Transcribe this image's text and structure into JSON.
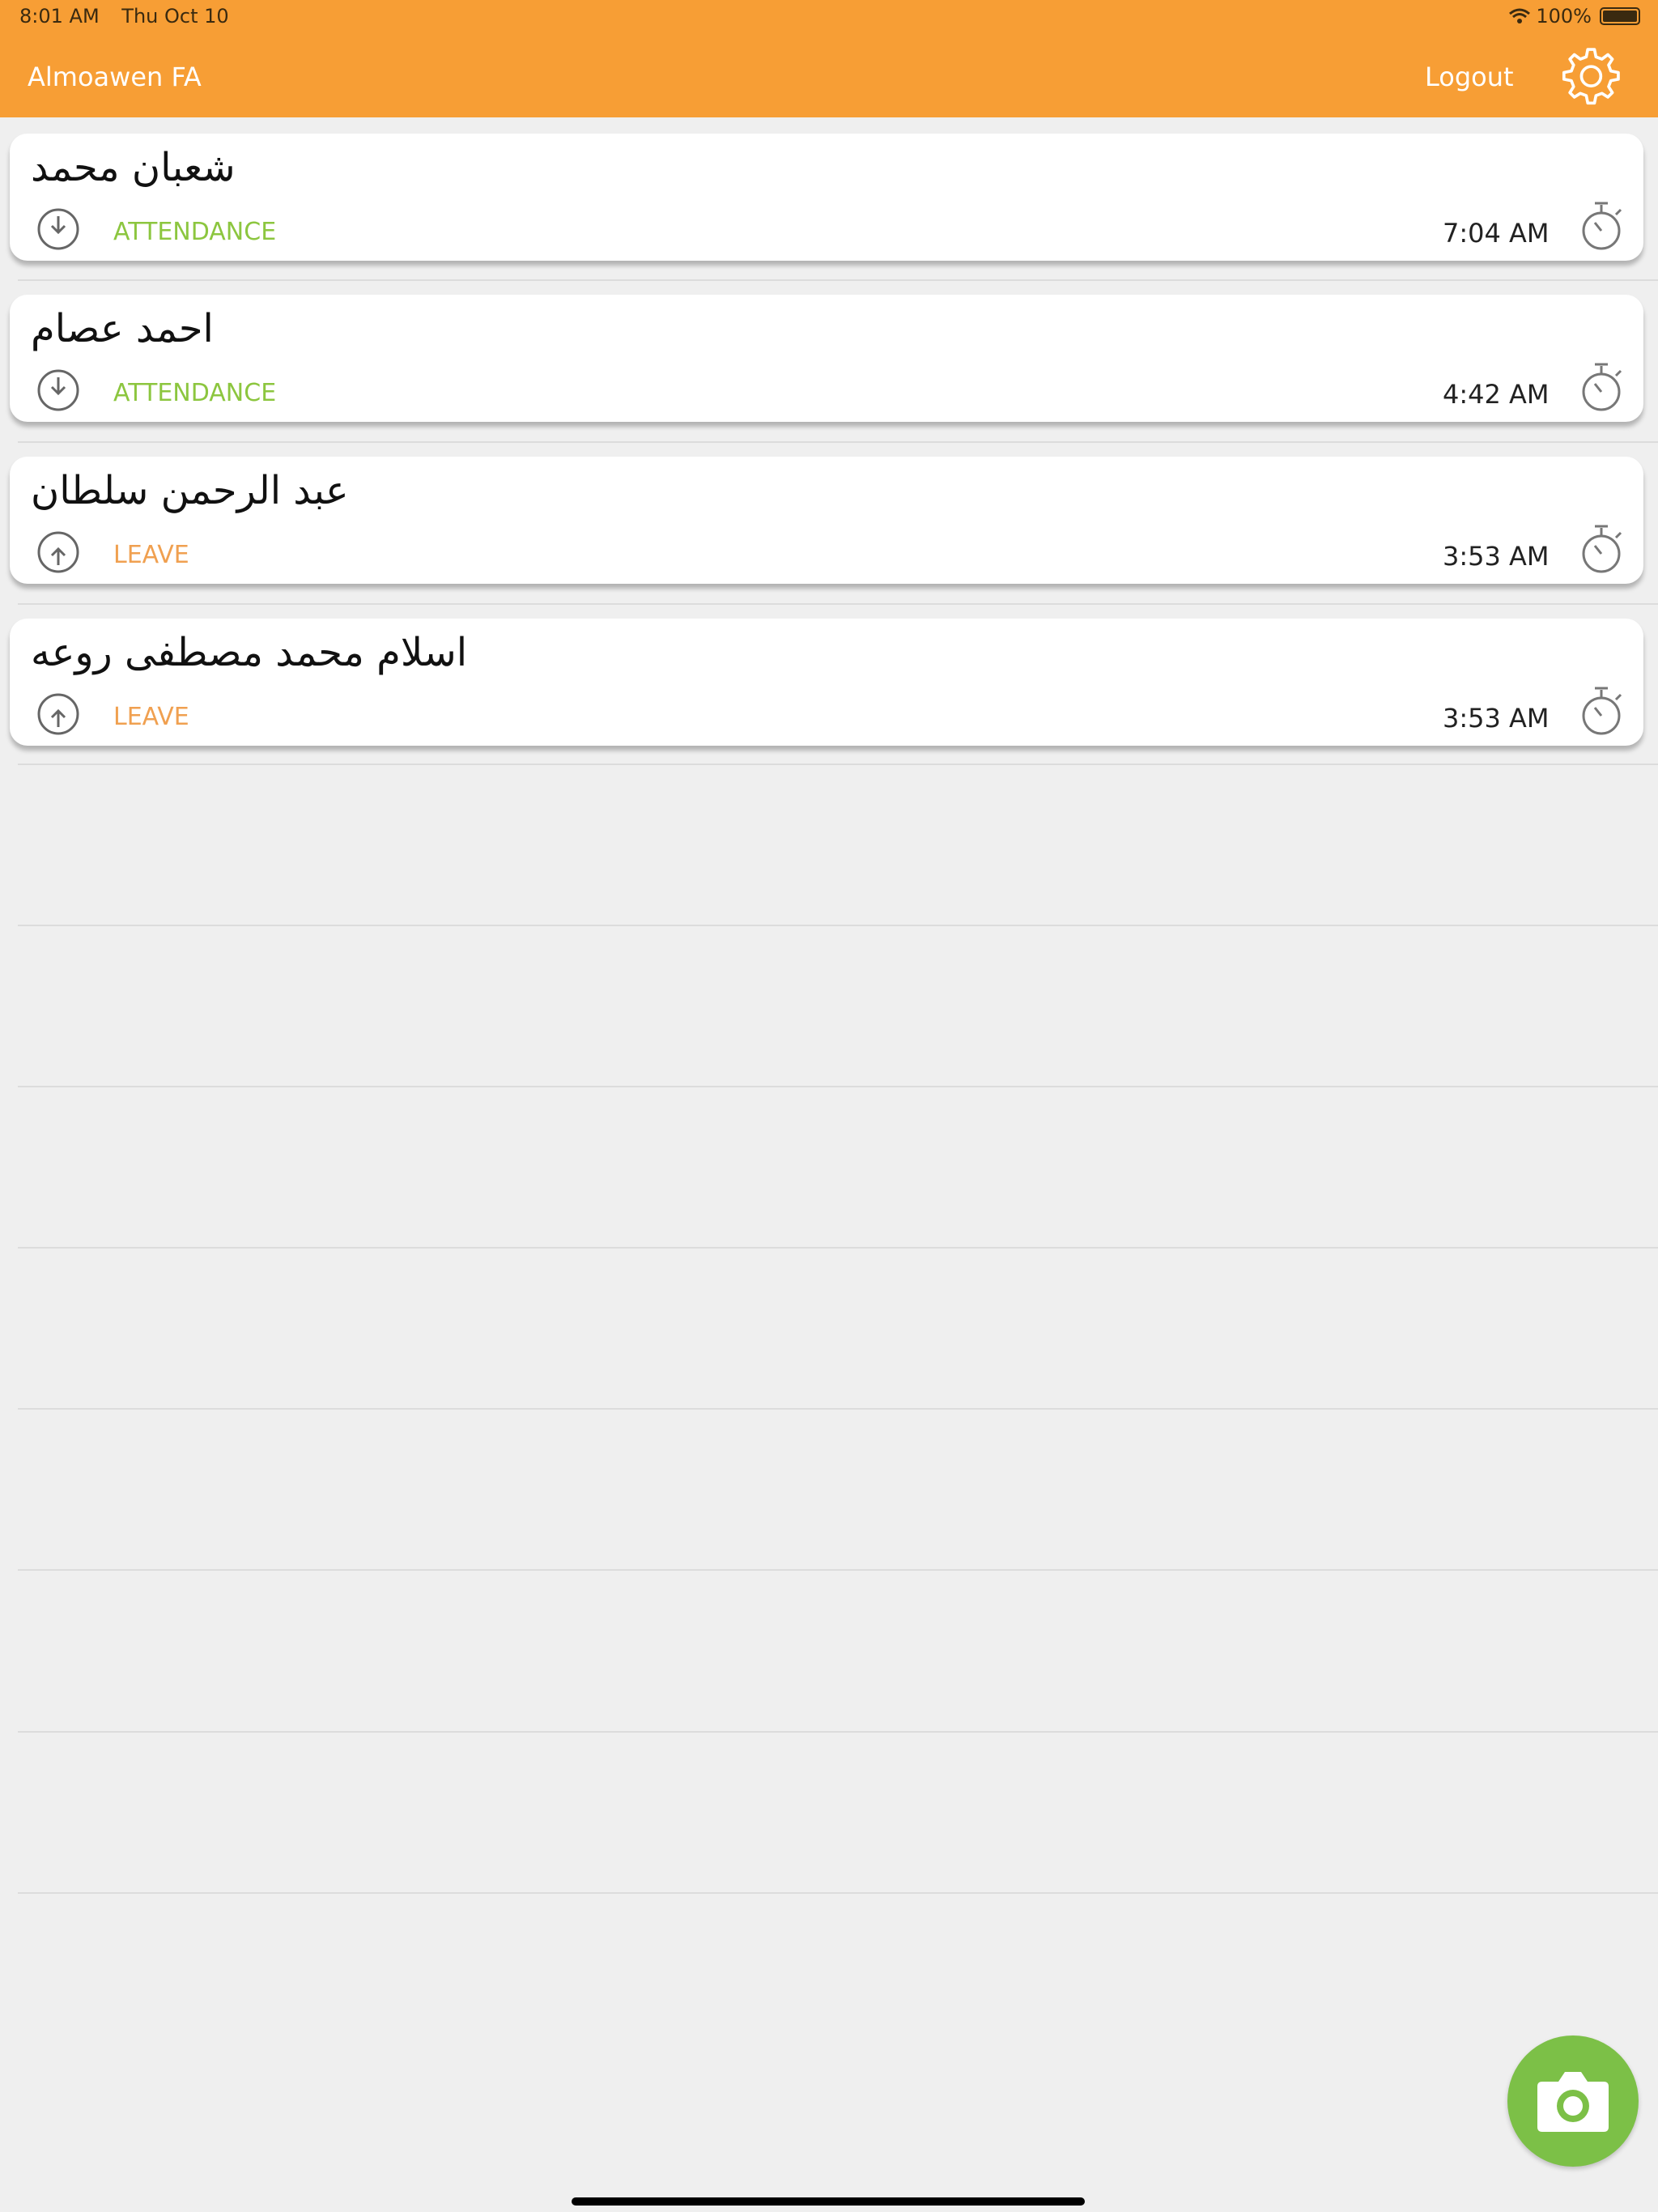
{
  "status_bar": {
    "time": "8:01 AM",
    "date": "Thu Oct 10",
    "battery": "100%"
  },
  "header": {
    "title": "Almoawen FA",
    "logout_label": "Logout",
    "settings_icon": "gear-icon",
    "background_color": "#f79e35"
  },
  "records": [
    {
      "name": "شعبان محمد",
      "type": "ATTENDANCE",
      "time": "7:04 AM"
    },
    {
      "name": "احمد عصام",
      "type": "ATTENDANCE",
      "time": "4:42 AM"
    },
    {
      "name": "عبد الرحمن سلطان",
      "type": "LEAVE",
      "time": "3:53 AM"
    },
    {
      "name": "اسلام محمد مصطفى  روعه",
      "type": "LEAVE",
      "time": "3:53 AM"
    }
  ],
  "colors": {
    "attendance": "#8cc63f",
    "leave": "#f0a050",
    "fab": "#7cc047"
  },
  "fab": {
    "icon": "camera-icon"
  }
}
